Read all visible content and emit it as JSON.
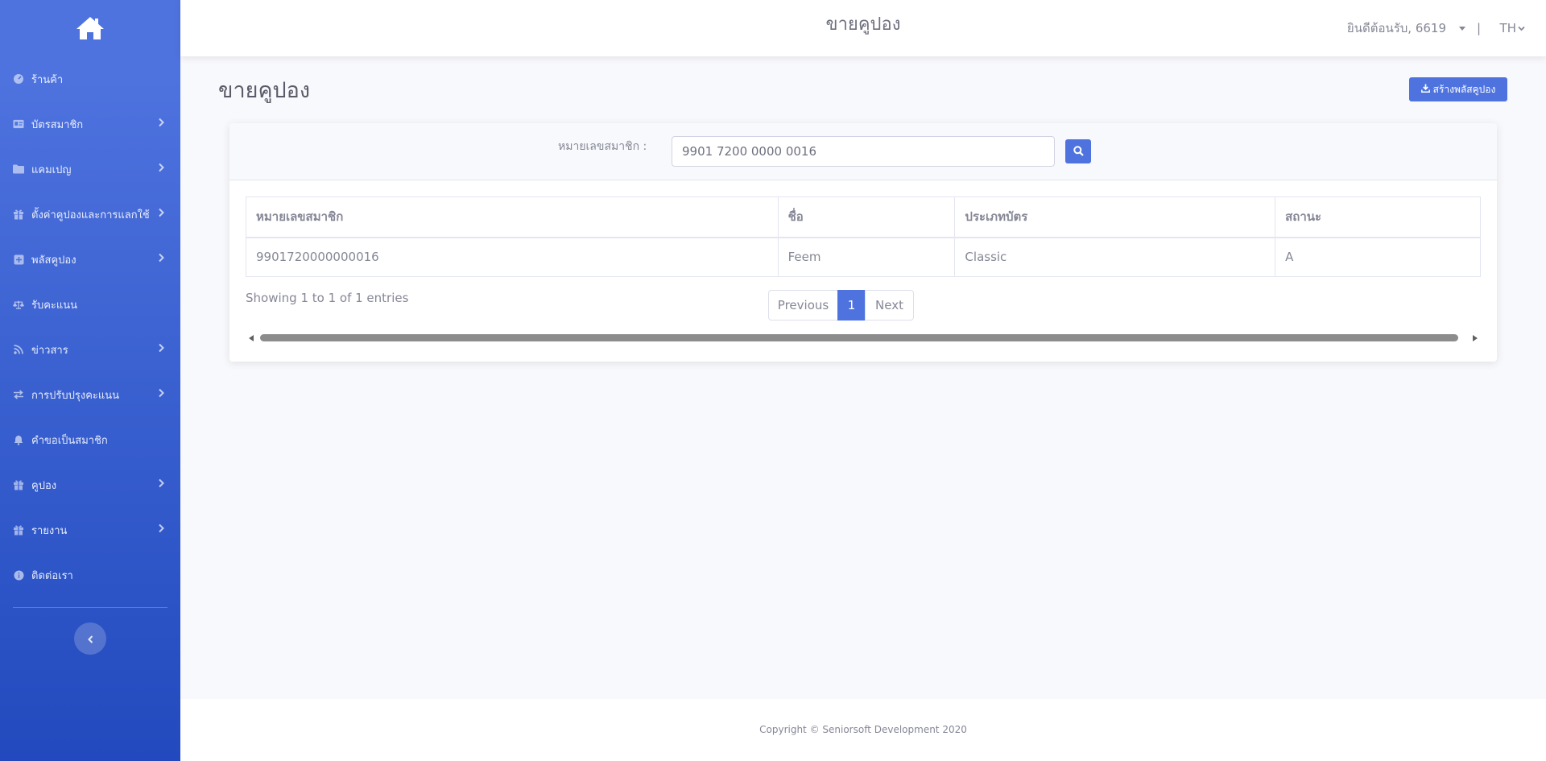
{
  "sidebar": {
    "items": [
      {
        "label": "ร้านค้า",
        "icon": "gauge-icon",
        "has_children": false
      },
      {
        "label": "บัตรสมาชิก",
        "icon": "id-card-icon",
        "has_children": true
      },
      {
        "label": "แคมเปญ",
        "icon": "folder-icon",
        "has_children": true
      },
      {
        "label": "ตั้งค่าคูปองและการแลกใช้",
        "icon": "gift-icon",
        "has_children": true
      },
      {
        "label": "พลัสคูปอง",
        "icon": "plus-square-icon",
        "has_children": true
      },
      {
        "label": "รับคะแนน",
        "icon": "balance-scale-icon",
        "has_children": false
      },
      {
        "label": "ข่าวสาร",
        "icon": "rss-icon",
        "has_children": true
      },
      {
        "label": "การปรับปรุงคะแนน",
        "icon": "exchange-icon",
        "has_children": true
      },
      {
        "label": "คำขอเป็นสมาชิก",
        "icon": "bell-icon",
        "has_children": false
      },
      {
        "label": "คูปอง",
        "icon": "gift-icon",
        "has_children": true
      },
      {
        "label": "รายงาน",
        "icon": "gift-icon",
        "has_children": true
      },
      {
        "label": "ติดต่อเรา",
        "icon": "info-circle-icon",
        "has_children": false
      }
    ]
  },
  "topbar": {
    "title": "ขายคูปอง",
    "welcome": "ยินดีต้อนรับ, 6619",
    "separator": "|",
    "language": "TH"
  },
  "page": {
    "title": "ขายคูปอง",
    "create_button": "สร้างพลัสคูปอง"
  },
  "search": {
    "label": "หมายเลขสมาชิก :",
    "value": "9901 7200 0000 0016"
  },
  "table": {
    "columns": [
      "หมายเลขสมาชิก",
      "ชื่อ",
      "ประเภทบัตร",
      "สถานะ"
    ],
    "rows": [
      [
        "9901720000000016",
        "Feem",
        "Classic",
        "A"
      ]
    ]
  },
  "pagination": {
    "info": "Showing 1 to 1 of 1 entries",
    "previous": "Previous",
    "current": "1",
    "next": "Next"
  },
  "footer": {
    "copyright": "Copyright © Seniorsoft Development 2020"
  },
  "colors": {
    "primary": "#4e73df",
    "sidebar_end": "#224abe",
    "text": "#858796",
    "background": "#f8f9fc"
  }
}
